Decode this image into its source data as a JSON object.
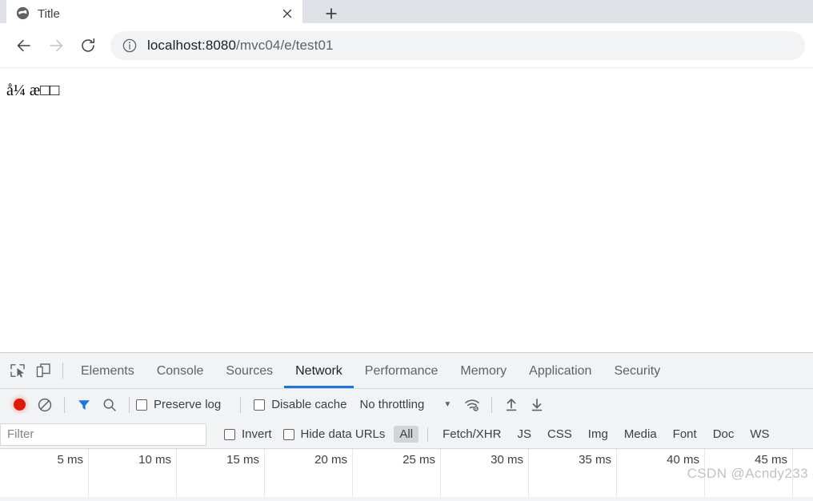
{
  "browser": {
    "tab": {
      "title": "Title",
      "favicon_name": "globe-favicon",
      "close_label": "×"
    },
    "new_tab_label": "+",
    "nav": {
      "back_label": "←",
      "forward_label": "→",
      "reload_label": "↻"
    },
    "omnibox": {
      "url_host": "localhost:8080",
      "url_path": "/mvc04/e/test01",
      "info_icon": "info-circle-icon"
    }
  },
  "page": {
    "text_prefix": "å¼¼",
    "text_mid": "æ",
    "full_text": "å¼ æ□□"
  },
  "devtools": {
    "left_icons": [
      {
        "name": "inspect-element-icon"
      },
      {
        "name": "device-toolbar-icon"
      }
    ],
    "tabs": [
      {
        "label": "Elements",
        "active": false
      },
      {
        "label": "Console",
        "active": false
      },
      {
        "label": "Sources",
        "active": false
      },
      {
        "label": "Network",
        "active": true
      },
      {
        "label": "Performance",
        "active": false
      },
      {
        "label": "Memory",
        "active": false
      },
      {
        "label": "Application",
        "active": false
      },
      {
        "label": "Security",
        "active": false
      }
    ],
    "network_toolbar": {
      "record_title": "record-button",
      "clear_title": "clear-button",
      "filter_title": "filter-toggle",
      "search_title": "search-button",
      "preserve_log_label": "Preserve log",
      "preserve_log_checked": false,
      "disable_cache_label": "Disable cache",
      "disable_cache_checked": false,
      "throttling_value": "No throttling",
      "caret": "▼",
      "wifi_title": "network-conditions-icon",
      "import_title": "import-har-icon",
      "export_title": "export-har-icon"
    },
    "filter_row": {
      "filter_placeholder": "Filter",
      "invert_label": "Invert",
      "invert_checked": false,
      "hide_data_urls_label": "Hide data URLs",
      "hide_data_urls_checked": false,
      "types": [
        {
          "label": "All",
          "selected": true
        },
        {
          "label": "Fetch/XHR",
          "selected": false
        },
        {
          "label": "JS",
          "selected": false
        },
        {
          "label": "CSS",
          "selected": false
        },
        {
          "label": "Img",
          "selected": false
        },
        {
          "label": "Media",
          "selected": false
        },
        {
          "label": "Font",
          "selected": false
        },
        {
          "label": "Doc",
          "selected": false
        },
        {
          "label": "WS",
          "selected": false
        }
      ]
    },
    "timeline": {
      "ticks": [
        "5 ms",
        "10 ms",
        "15 ms",
        "20 ms",
        "25 ms",
        "30 ms",
        "35 ms",
        "40 ms",
        "45 ms"
      ]
    }
  },
  "watermark": "CSDN @Acndy233",
  "colors": {
    "accent": "#1a73e8",
    "record": "#e11900",
    "panel_bg": "#f1f3f4",
    "tabstrip_bg": "#dee1e6"
  }
}
